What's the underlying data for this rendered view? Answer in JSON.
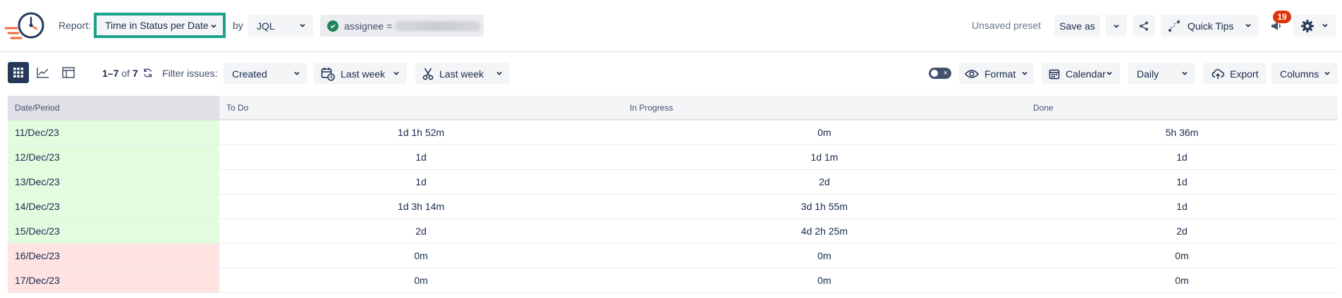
{
  "header": {
    "report_label": "Report:",
    "report_value": "Time in Status per Date",
    "by_label": "by",
    "query_type": "JQL",
    "filter_chip": "assignee =",
    "unsaved_preset": "Unsaved preset",
    "save_as": "Save as",
    "quick_tips": "Quick Tips",
    "notifications_count": "19"
  },
  "toolbar": {
    "range_text": "1–7",
    "range_of": "of",
    "range_total": "7",
    "filter_issues_label": "Filter issues:",
    "filter_field": "Created",
    "date_range_1": "Last week",
    "date_range_2": "Last week",
    "format": "Format",
    "calendar": "Calendar",
    "granularity": "Daily",
    "export": "Export",
    "columns": "Columns"
  },
  "table": {
    "headers": [
      "Date/Period",
      "To Do",
      "In Progress",
      "Done"
    ],
    "rows": [
      {
        "date": "11/Dec/23",
        "todo": "1d 1h 52m",
        "in_progress": "0m",
        "done": "5h 36m",
        "type": "workday"
      },
      {
        "date": "12/Dec/23",
        "todo": "1d",
        "in_progress": "1d 1m",
        "done": "1d",
        "type": "workday"
      },
      {
        "date": "13/Dec/23",
        "todo": "1d",
        "in_progress": "2d",
        "done": "1d",
        "type": "workday"
      },
      {
        "date": "14/Dec/23",
        "todo": "1d 3h 14m",
        "in_progress": "3d 1h 55m",
        "done": "1d",
        "type": "workday"
      },
      {
        "date": "15/Dec/23",
        "todo": "2d",
        "in_progress": "4d 2h 25m",
        "done": "2d",
        "type": "workday"
      },
      {
        "date": "16/Dec/23",
        "todo": "0m",
        "in_progress": "0m",
        "done": "0m",
        "type": "weekend"
      },
      {
        "date": "17/Dec/23",
        "todo": "0m",
        "in_progress": "0m",
        "done": "0m",
        "type": "weekend"
      }
    ]
  },
  "colors": {
    "accent": "#1aa38a",
    "workday": "#e3fcdf",
    "weekend": "#ffe2e2",
    "badge": "#de350b"
  }
}
